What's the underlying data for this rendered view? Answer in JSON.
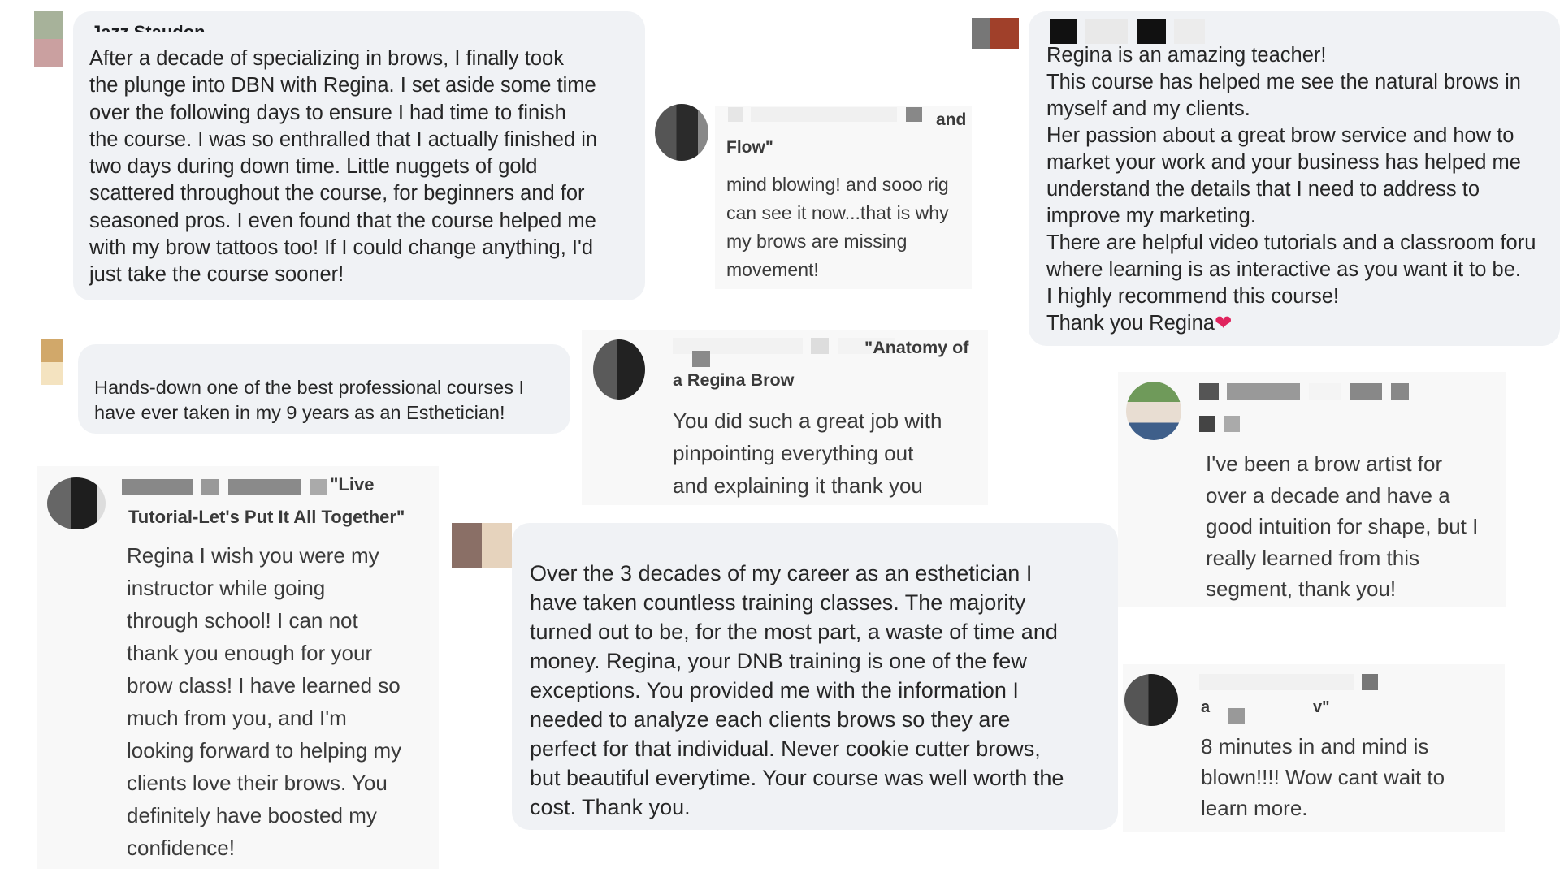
{
  "reviews": [
    {
      "author": "Jazz Staudon",
      "body": "After a decade of specializing in brows, I finally took\nthe plunge into DBN with Regina. I set aside some time\nover the following days to ensure I had time to finish\nthe course. I was so enthralled that I actually finished in\ntwo days during down time. Little nuggets of gold\nscattered throughout the course, for beginners and for\nseasoned pros. I even found that the course helped me\nwith my brow tattoos too! If I could change anything, I'd\njust take the course sooner!"
    },
    {
      "title_a": "and",
      "title_b": "Flow\"",
      "body": "mind blowing! and sooo rig\ncan see it now...that is why\nmy brows are missing\nmovement!"
    },
    {
      "body": "Regina is an amazing teacher!\nThis course has helped me see the natural brows in\nmyself and my clients.\nHer passion about a great brow service and how to\nmarket your work and your business has helped me\nunderstand the details that I need to address to\nimprove my marketing.\nThere are helpful video tutorials and a classroom foru\nwhere learning is as interactive as you want it to be.\nI highly recommend this course!\nThank you Regina",
      "heart": "❤"
    },
    {
      "body": "Hands-down one of the best professional courses I\nhave ever taken in my 9 years as an Esthetician!"
    },
    {
      "title_a": "\"Anatomy of",
      "title_b": "a Regina Brow",
      "body": "You did such a great job with\npinpointing everything out\nand explaining it thank you"
    },
    {
      "body": "I've been a brow artist for\nover a decade and have a\ngood intuition for shape, but I\nreally learned from this\nsegment, thank you!"
    },
    {
      "title_a": "\"Live",
      "title_b": "Tutorial-Let's Put It All Together\"",
      "body": "Regina I wish you were my\ninstructor while going\nthrough school! I can not\nthank you enough for your\nbrow class! I have learned so\nmuch from you, and I'm\nlooking forward to helping my\nclients love their brows. You\ndefinitely have boosted my\nconfidence!"
    },
    {
      "body": "Over the 3 decades of my career as an esthetician I\nhave taken countless training classes. The majority\nturned out to be, for the most part, a waste of time and\nmoney. Regina, your DNB training is one of the few\nexceptions. You provided me with the information I\nneeded to analyze each clients brows so they are\nperfect for that individual. Never cookie cutter brows,\nbut beautiful everytime. Your course was well worth the\ncost. Thank you."
    },
    {
      "title_a": "a",
      "title_b": "v\"",
      "body": "8 minutes in and mind is\nblown!!!! Wow cant wait to\nlearn more."
    }
  ],
  "colors": {
    "bubble": "#f0f2f5",
    "soft_card": "#f8f8f8",
    "text": "#1c1e21",
    "heart": "#e0245e"
  }
}
